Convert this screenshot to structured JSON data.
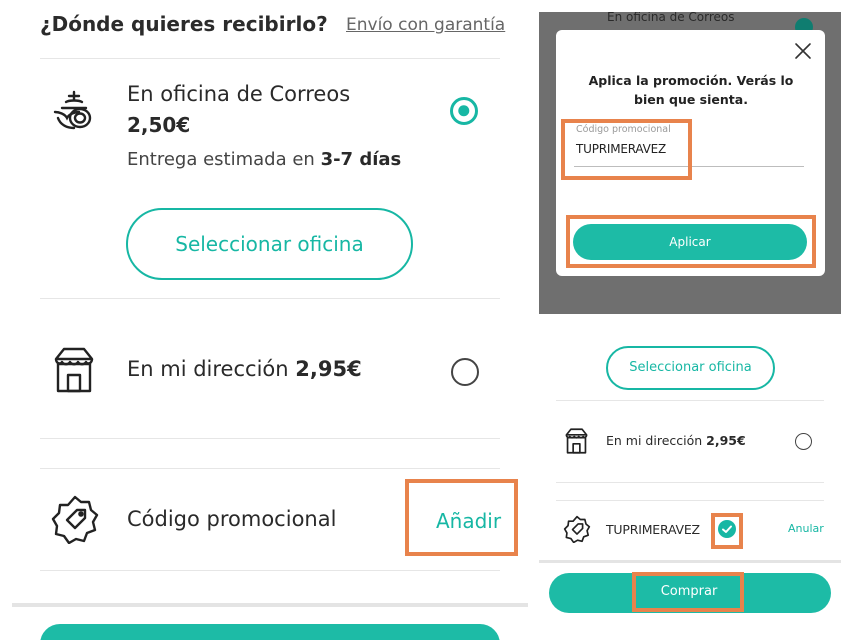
{
  "left": {
    "heading": "¿Dónde quieres recibirlo?",
    "guarantee_link": "Envío con garantía",
    "office_option": {
      "title": "En oficina de Correos",
      "price": "2,50€",
      "eta_prefix": "Entrega estimada en ",
      "eta_days": "3-7 días",
      "select_button": "Seleccionar oficina",
      "icon": "correos-horn-icon",
      "selected": true
    },
    "home_option": {
      "title": "En mi dirección ",
      "price": "2,95€",
      "icon": "house-icon",
      "selected": false
    },
    "promo": {
      "label": "Código promocional",
      "add_link": "Añadir",
      "icon": "badge-tag-icon"
    }
  },
  "modal": {
    "background_title": "En oficina de Correos",
    "message": "Aplica la promoción. Verás lo bien que sienta.",
    "field_label": "Código promocional",
    "field_value": "TUPRIMERAVEZ",
    "apply_button": "Aplicar",
    "close_icon": "close-icon"
  },
  "right_bottom": {
    "select_button": "Seleccionar oficina",
    "home_title": "En mi dirección ",
    "home_price": "2,95€",
    "promo_code": "TUPRIMERAVEZ",
    "cancel_link": "Anular",
    "buy_button": "Comprar"
  },
  "colors": {
    "accent": "#17b7a4",
    "highlight": "#e8834c",
    "overlay": "#6f6f6f"
  }
}
